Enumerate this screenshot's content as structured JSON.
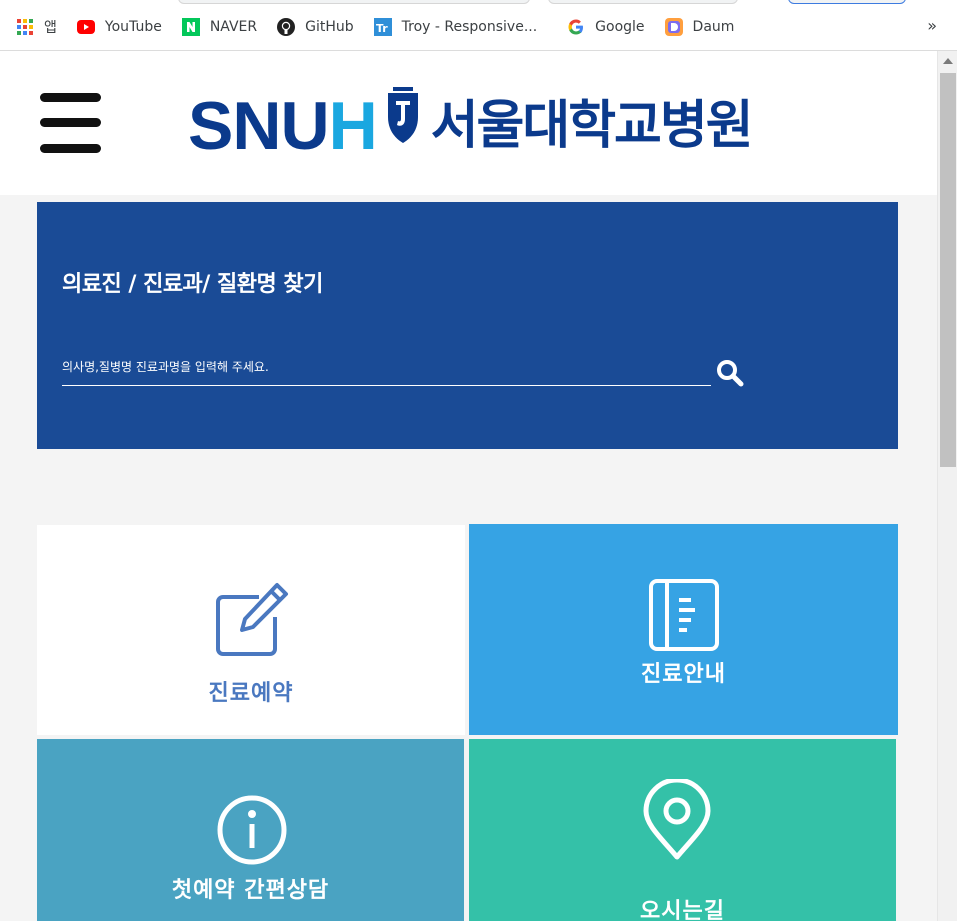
{
  "bookmarks": {
    "items": [
      {
        "label": "앱",
        "icon": "apps-grid-icon"
      },
      {
        "label": "YouTube",
        "icon": "youtube-icon"
      },
      {
        "label": "NAVER",
        "icon": "naver-icon"
      },
      {
        "label": "GitHub",
        "icon": "github-icon"
      },
      {
        "label": "Troy - Responsive...",
        "icon": "troy-icon"
      },
      {
        "label": "Google",
        "icon": "google-icon"
      },
      {
        "label": "Daum",
        "icon": "daum-icon"
      }
    ],
    "more": "»"
  },
  "header": {
    "logo": {
      "en_prefix": "SNU",
      "en_suffix": "H",
      "kr": "서울대학교병원"
    }
  },
  "search": {
    "title": "의료진 / 진료과/ 질환명 찾기",
    "placeholder": "의사명,질병명 진료과명을 입력해 주세요.",
    "value": ""
  },
  "tiles": [
    {
      "label": "진료예약",
      "icon": "reservation-edit-icon",
      "bg": "#ffffff",
      "fg": "#4a78c0"
    },
    {
      "label": "진료안내",
      "icon": "notebook-icon",
      "bg": "#36a3e4",
      "fg": "#ffffff"
    },
    {
      "label": "첫예약 간편상담",
      "icon": "info-icon",
      "bg": "#4aa3c2",
      "fg": "#ffffff"
    },
    {
      "label": "오시는길",
      "icon": "location-pin-icon",
      "bg": "#34c1a8",
      "fg": "#ffffff"
    }
  ],
  "colors": {
    "search_panel": "#1a4b96",
    "logo_navy": "#0b3a8c",
    "logo_blue": "#1aa7e0"
  }
}
